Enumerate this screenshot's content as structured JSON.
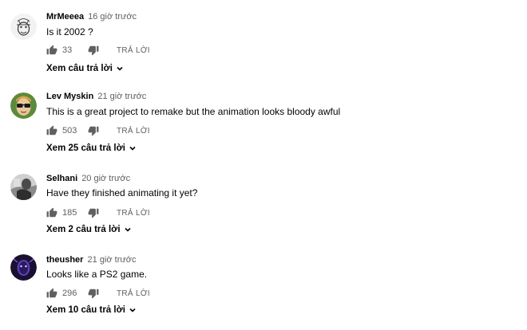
{
  "comments": [
    {
      "author": "MrMeeea",
      "time": "16 giờ trước",
      "text": "Is it 2002 ?",
      "likes": "33",
      "reply_label": "TRẢ LỜI",
      "view_replies": "Xem câu trả lời",
      "avatar_icon": "sketch-face-avatar"
    },
    {
      "author": "Lev Myskin",
      "time": "21 giờ trước",
      "text": "This is a great project to remake but the animation looks bloody awful",
      "likes": "503",
      "reply_label": "TRẢ LỜI",
      "view_replies": "Xem 25 câu trả lời",
      "avatar_icon": "sunglasses-face-avatar"
    },
    {
      "author": "Selhani",
      "time": "20 giờ trước",
      "text": "Have they finished animating it yet?",
      "likes": "185",
      "reply_label": "TRẢ LỜI",
      "view_replies": "Xem 2 câu trả lời",
      "avatar_icon": "grayscale-photo-avatar"
    },
    {
      "author": "theusher",
      "time": "21 giờ trước",
      "text": "Looks like a PS2 game.",
      "likes": "296",
      "reply_label": "TRẢ LỜI",
      "view_replies": "Xem 10 câu trả lời",
      "avatar_icon": "neon-face-avatar"
    }
  ]
}
